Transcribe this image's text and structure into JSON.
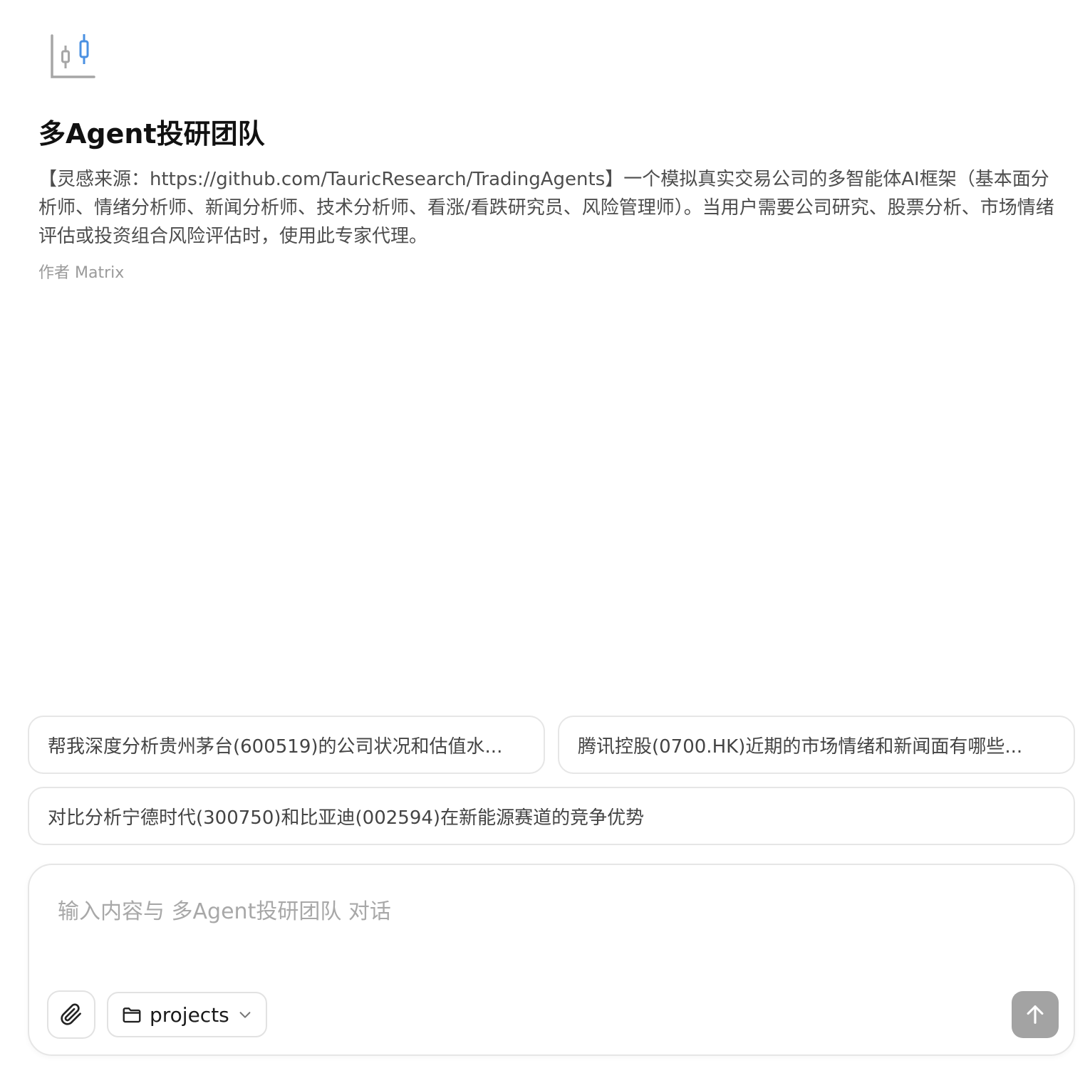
{
  "agent": {
    "logo_icon": "candlestick-chart-icon",
    "title": "多Agent投研团队",
    "description": "【灵感来源：https://github.com/TauricResearch/TradingAgents】一个模拟真实交易公司的多智能体AI框架（基本面分析师、情绪分析师、新闻分析师、技术分析师、看涨/看跌研究员、风险管理师）。当用户需要公司研究、股票分析、市场情绪评估或投资组合风险评估时，使用此专家代理。",
    "author": "作者 Matrix"
  },
  "suggestions": [
    "帮我深度分析贵州茅台(600519)的公司状况和估值水...",
    "腾讯控股(0700.HK)近期的市场情绪和新闻面有哪些...",
    "对比分析宁德时代(300750)和比亚迪(002594)在新能源赛道的竞争优势"
  ],
  "composer": {
    "placeholder": "输入内容与 多Agent投研团队 对话",
    "attach_icon": "paperclip-icon",
    "folder_icon": "folder-icon",
    "folder_label": "projects",
    "dropdown_icon": "chevron-down-icon",
    "send_icon": "arrow-up-icon"
  },
  "colors": {
    "logo_gray": "#9e9e9e",
    "logo_accent": "#4a90e2",
    "send_button_bg": "#a3a3a3",
    "border": "#e6e6e6"
  }
}
